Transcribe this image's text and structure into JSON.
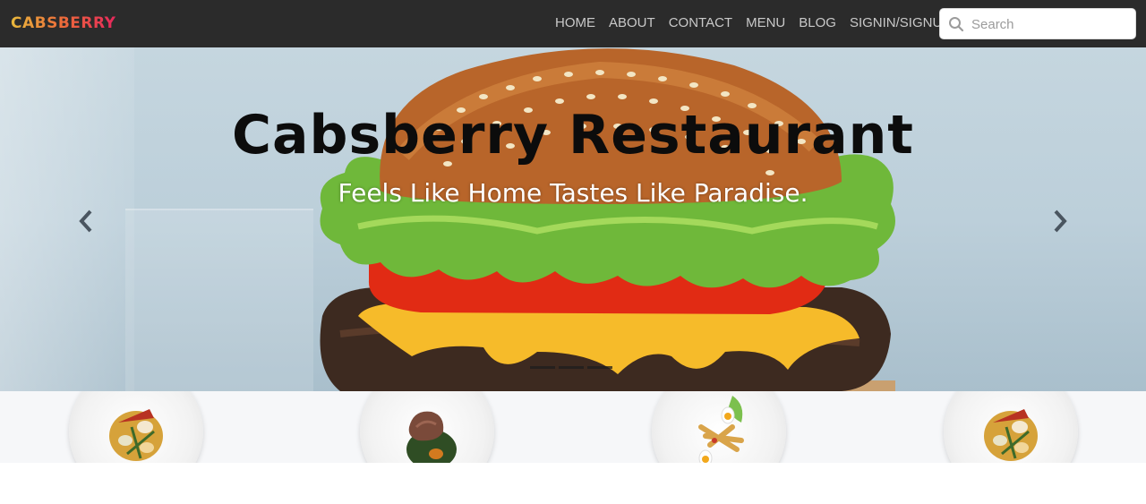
{
  "brand": {
    "name": "CABSBERRY"
  },
  "nav": {
    "items": [
      "HOME",
      "ABOUT",
      "CONTACT",
      "MENU",
      "BLOG",
      "SIGNIN/SIGNUP"
    ]
  },
  "search": {
    "placeholder": "Search",
    "value": ""
  },
  "hero": {
    "title": "Cabsberry Restaurant",
    "subtitle": "Feels Like Home Tastes Like Paradise."
  },
  "carousel": {
    "slides": 3,
    "active": 1
  },
  "dishes": [
    "seafood-dish",
    "steak-dish",
    "salad-dish",
    "seafood-dish"
  ],
  "colors": {
    "navbar": "#2b2b2b",
    "brand_start": "#e8b93c",
    "brand_end": "#e6285c",
    "nav_text": "#c9c9c9"
  }
}
